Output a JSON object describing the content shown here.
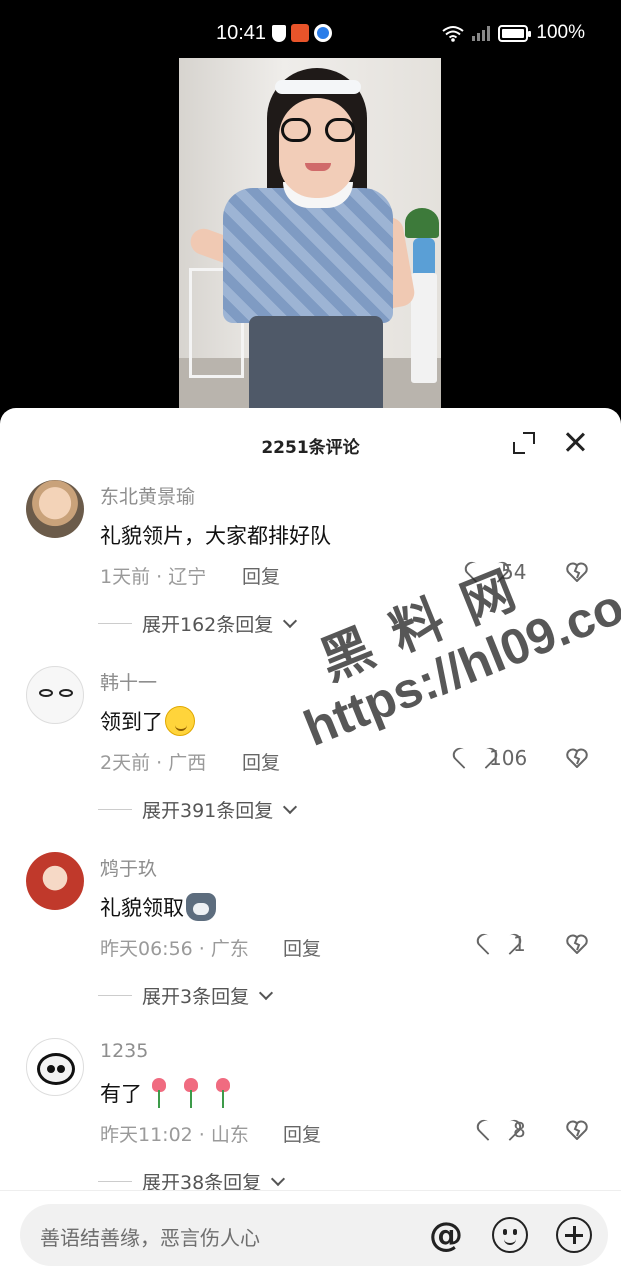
{
  "status_bar": {
    "time": "10:41",
    "battery": "100%"
  },
  "sheet": {
    "title": "2251条评论"
  },
  "comments": [
    {
      "user": "东北黄景瑜",
      "text": "礼貌领片，大家都排好队",
      "meta": "1天前 · 辽宁",
      "reply": "回复",
      "likes": "54",
      "expand": "展开162条回复"
    },
    {
      "user": "韩十一",
      "text": "领到了",
      "meta": "2天前 · 广西",
      "reply": "回复",
      "likes": "106",
      "expand": "展开391条回复"
    },
    {
      "user": "鸩于玖",
      "text": "礼貌领取",
      "meta": "昨天06:56 · 广东",
      "reply": "回复",
      "likes": "1",
      "expand": "展开3条回复"
    },
    {
      "user": "1235",
      "text": "有了",
      "meta": "昨天11:02 · 山东",
      "reply": "回复",
      "likes": "8",
      "expand": "展开38条回复"
    }
  ],
  "watermark": {
    "line1": "黑料网",
    "line2": "https://hl09.co"
  },
  "input": {
    "placeholder": "善语结善缘，恶言伤人心",
    "at_symbol": "@"
  },
  "colors": {
    "sheet_bg": "#ffffff",
    "text_primary": "#111111",
    "text_secondary": "#8e8e8e"
  }
}
